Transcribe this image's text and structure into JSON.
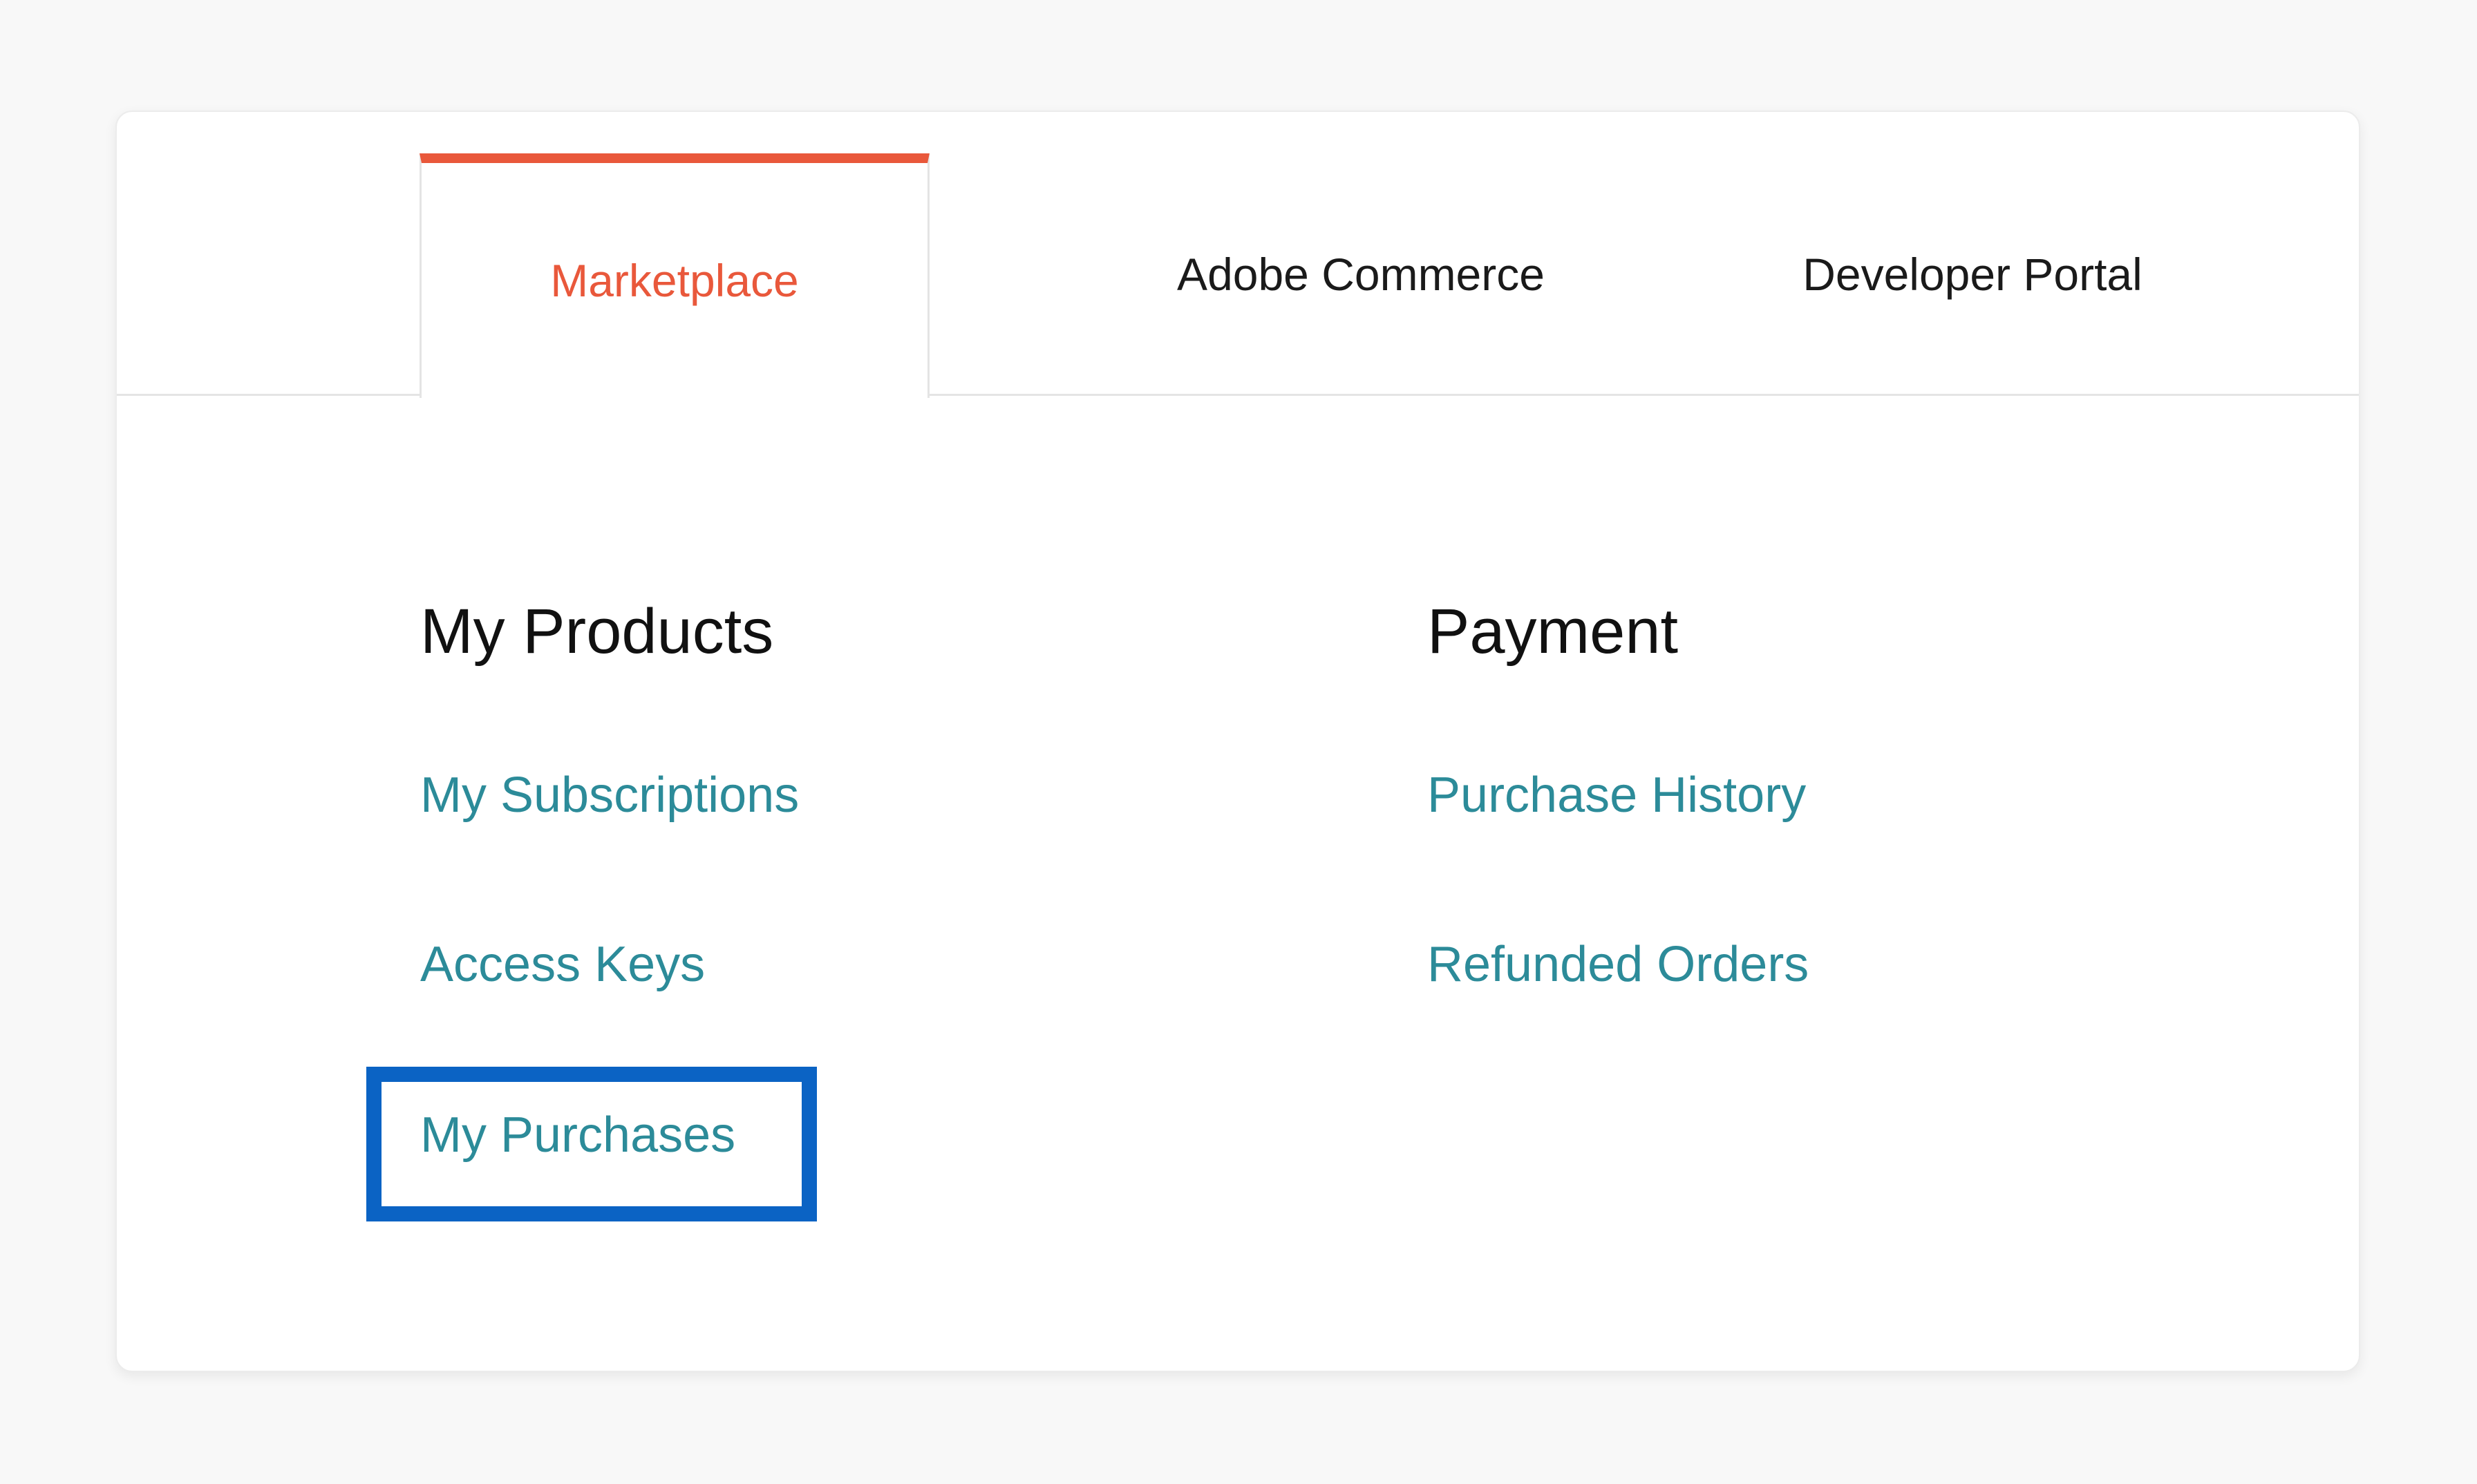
{
  "tabs": [
    {
      "label": "Marketplace",
      "active": true
    },
    {
      "label": "Adobe Commerce",
      "active": false
    },
    {
      "label": "Developer Portal",
      "active": false
    }
  ],
  "sections": {
    "my_products": {
      "title": "My Products",
      "links": [
        "My Subscriptions",
        "Access Keys",
        "My Purchases"
      ]
    },
    "payment": {
      "title": "Payment",
      "links": [
        "Purchase History",
        "Refunded Orders"
      ]
    }
  },
  "colors": {
    "accent": "#e9583b",
    "link": "#2c8b99",
    "highlight": "#0b63c4"
  }
}
